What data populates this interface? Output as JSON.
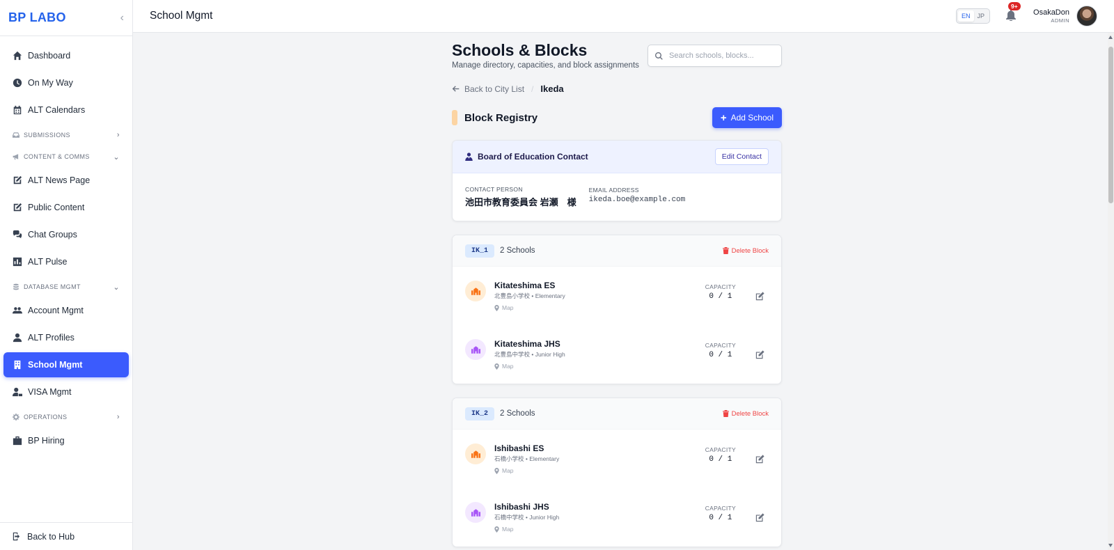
{
  "sidebar": {
    "brand": "BP LABO",
    "collapse_icon": "‹",
    "items": [
      {
        "label": "Dashboard",
        "icon": "home-icon"
      },
      {
        "label": "On My Way",
        "icon": "clock-icon"
      },
      {
        "label": "ALT Calendars",
        "icon": "calendar-icon"
      }
    ],
    "section_submissions": "SUBMISSIONS",
    "section_content": "CONTENT & COMMS",
    "content_items": [
      {
        "label": "ALT News Page",
        "icon": "edit-square-icon"
      },
      {
        "label": "Public Content",
        "icon": "edit-square-icon"
      },
      {
        "label": "Chat Groups",
        "icon": "chat-icon"
      },
      {
        "label": "ALT Pulse",
        "icon": "bar-chart-icon"
      }
    ],
    "section_database": "DATABASE MGMT",
    "database_items": [
      {
        "label": "Account Mgmt",
        "icon": "users-icon"
      },
      {
        "label": "ALT Profiles",
        "icon": "user-icon"
      },
      {
        "label": "School Mgmt",
        "icon": "building-icon",
        "active": true
      },
      {
        "label": "VISA Mgmt",
        "icon": "user-card-icon"
      }
    ],
    "section_operations": "OPERATIONS",
    "operations_items": [
      {
        "label": "BP Hiring",
        "icon": "briefcase-icon"
      }
    ],
    "footer": "Back to Hub"
  },
  "topbar": {
    "title": "School Mgmt",
    "lang_en": "EN",
    "lang_jp": "JP",
    "notif_badge": "9+",
    "user_name": "OsakaDon",
    "user_role": "ADMIN"
  },
  "page": {
    "title": "Schools & Blocks",
    "subtitle": "Manage directory, capacities, and block assignments",
    "search_placeholder": "Search schools, blocks...",
    "back_link": "Back to City List",
    "crumb_sep": "/",
    "current_city": "Ikeda",
    "registry_title": "Block Registry",
    "add_school": "Add School"
  },
  "contact": {
    "title": "Board of Education Contact",
    "edit_label": "Edit Contact",
    "person_label": "CONTACT PERSON",
    "person_value": "池田市教育委員会 岩瀬　様",
    "email_label": "EMAIL ADDRESS",
    "email_value": "ikeda.boe@example.com"
  },
  "blocks": [
    {
      "code": "IK_1",
      "count": "2 Schools",
      "delete_label": "Delete Block",
      "schools": [
        {
          "name": "Kitateshima ES",
          "sub": "北豊島小学校 • Elementary",
          "map": "Map",
          "cap_label": "CAPACITY",
          "capacity": "0 / 1",
          "kind": "es"
        },
        {
          "name": "Kitateshima JHS",
          "sub": "北豊島中学校 • Junior High",
          "map": "Map",
          "cap_label": "CAPACITY",
          "capacity": "0 / 1",
          "kind": "jhs"
        }
      ]
    },
    {
      "code": "IK_2",
      "count": "2 Schools",
      "delete_label": "Delete Block",
      "schools": [
        {
          "name": "Ishibashi ES",
          "sub": "石橋小学校 • Elementary",
          "map": "Map",
          "cap_label": "CAPACITY",
          "capacity": "0 / 1",
          "kind": "es"
        },
        {
          "name": "Ishibashi JHS",
          "sub": "石橋中学校 • Junior High",
          "map": "Map",
          "cap_label": "CAPACITY",
          "capacity": "0 / 1",
          "kind": "jhs"
        }
      ]
    }
  ],
  "colors": {
    "accent": "#3b5bfd",
    "brand": "#2563eb",
    "danger": "#ef4444",
    "badge": "#dc2626"
  }
}
